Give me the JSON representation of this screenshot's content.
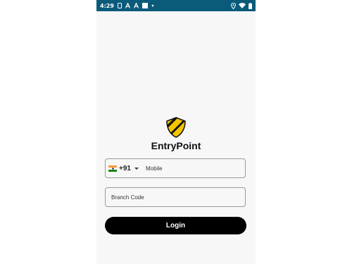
{
  "status_bar": {
    "time": "4:29",
    "left_icons": [
      "sim-icon",
      "a-icon",
      "a-icon",
      "square-icon",
      "dot-icon"
    ],
    "right_icons": [
      "location-icon",
      "wifi-icon",
      "battery-icon"
    ]
  },
  "app": {
    "name": "EntryPoint",
    "logo": "shield-logo-icon",
    "colors": {
      "logo_yellow": "#f5c400",
      "logo_black": "#111111"
    }
  },
  "login_form": {
    "country": {
      "flag": "india-flag-icon",
      "code": "+91"
    },
    "mobile_placeholder": "Mobile",
    "branch_placeholder": "Branch Code",
    "login_label": "Login"
  },
  "colors": {
    "status_bar": "#0a5a7a",
    "button": "#000000",
    "button_text": "#ffffff"
  }
}
